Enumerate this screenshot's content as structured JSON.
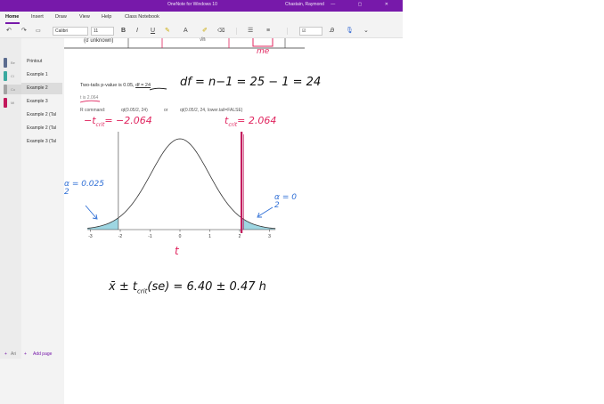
{
  "window": {
    "app_title": "OneNote for Windows 10",
    "user_name": "Chastain, Raymond",
    "controls": "— ▢ ✕"
  },
  "ribbon": {
    "tabs": [
      "Home",
      "Insert",
      "Draw",
      "View",
      "Help",
      "Class Notebook"
    ],
    "active_tab": "Home"
  },
  "toolbar": {
    "font_name": "Calibri",
    "font_size": "11",
    "bold": "B",
    "italic": "I",
    "underline": "U"
  },
  "sections": [
    {
      "label": "Be",
      "color": "#5b6c8f"
    },
    {
      "label": "Cl",
      "color": "#3aa99f"
    },
    {
      "label": "Co",
      "color": "#a3a3a3"
    },
    {
      "label": "Mi",
      "color": "#c2185b"
    }
  ],
  "pages": [
    {
      "label": "Printout",
      "selected": false
    },
    {
      "label": "Example 1",
      "selected": false
    },
    {
      "label": "Example 2",
      "selected": true
    },
    {
      "label": "Example 3",
      "selected": false
    },
    {
      "label": "Example 2 (Tal",
      "selected": false
    },
    {
      "label": "Example 2 (Tal",
      "selected": false
    },
    {
      "label": "Example 3 (Tal",
      "selected": false
    }
  ],
  "nav_bottom": {
    "add_section_icon": "+",
    "add_section": "Ari",
    "add_page_icon": "+",
    "add_page": "Add page"
  },
  "note": {
    "top_fragment": "(σ unknown)",
    "top_sqrt": "√n",
    "top_me": "me",
    "line1_prefix": "Two-tails p-value is 0.05, ",
    "line1_df": "df = 24",
    "line2": "t is 2.064",
    "line3_a": "R command:",
    "line3_b": "qt(0.05/2, 24)",
    "line3_or": "or",
    "line3_c": "qt(0.05/2, 24, lower.tail=FALSE)",
    "hand_df": "df = n−1 = 25 − 1 = 24",
    "hand_neg_t": "−t",
    "hand_neg_t_sub": "crit",
    "hand_neg_t_val": "= −2.064",
    "hand_pos_t": "t",
    "hand_pos_t_sub": "crit",
    "hand_pos_t_val": "= 2.064",
    "hand_alpha_left_1": "α",
    "hand_alpha_left_2": "= 0.025",
    "hand_alpha_left_3": "2",
    "hand_alpha_right_1": "α",
    "hand_alpha_right_2": "= 0",
    "hand_alpha_right_3": "2",
    "hand_t_axis": "t",
    "hand_formula": "x̄ ± t",
    "hand_formula_sub": "crit",
    "hand_formula_rest": "(se) = 6.40 ± 0.47 h"
  },
  "chart_data": {
    "type": "area",
    "x_ticks": [
      "-3",
      "-2",
      "-1",
      "0",
      "1",
      "2",
      "3"
    ],
    "xlim": [
      -3,
      3.2
    ],
    "critical_values": [
      -2.064,
      2.064
    ],
    "shaded_tails": "both",
    "colors": {
      "tail": "#7ec8d8",
      "curve": "#333333",
      "critical": "#c2185b",
      "ink": "#e0245e"
    }
  }
}
